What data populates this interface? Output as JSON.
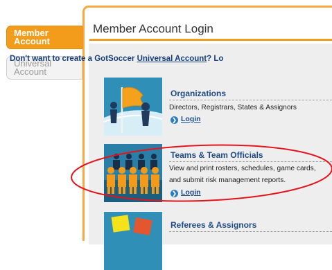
{
  "tabs": {
    "member_account": "Member\nAccount",
    "universal_account": "Universal\nAccount"
  },
  "panel": {
    "title": "Member Account Login",
    "promo_prefix": "Don't want to create a GotSoccer ",
    "promo_link": "Universal Account",
    "promo_suffix": "? Lo"
  },
  "sections": [
    {
      "title": "Organizations",
      "description_lines": [
        "Directors, Registrars, States & Assignors"
      ],
      "login_label": "Login",
      "icon": "flag-icon"
    },
    {
      "title": "Teams & Team Officials",
      "description_lines": [
        "View and print rosters, schedules, game cards,",
        "and submit risk management reports."
      ],
      "login_label": "Login",
      "icon": "team-icon"
    },
    {
      "title": "Referees & Assignors",
      "description_lines": [],
      "login_label": "",
      "icon": "referee-cards-icon"
    }
  ],
  "annotation": {
    "color": "#e3141b",
    "shape": "ellipse"
  },
  "colors": {
    "accent_orange": "#f39c1b",
    "link_blue": "#1e4b86"
  }
}
